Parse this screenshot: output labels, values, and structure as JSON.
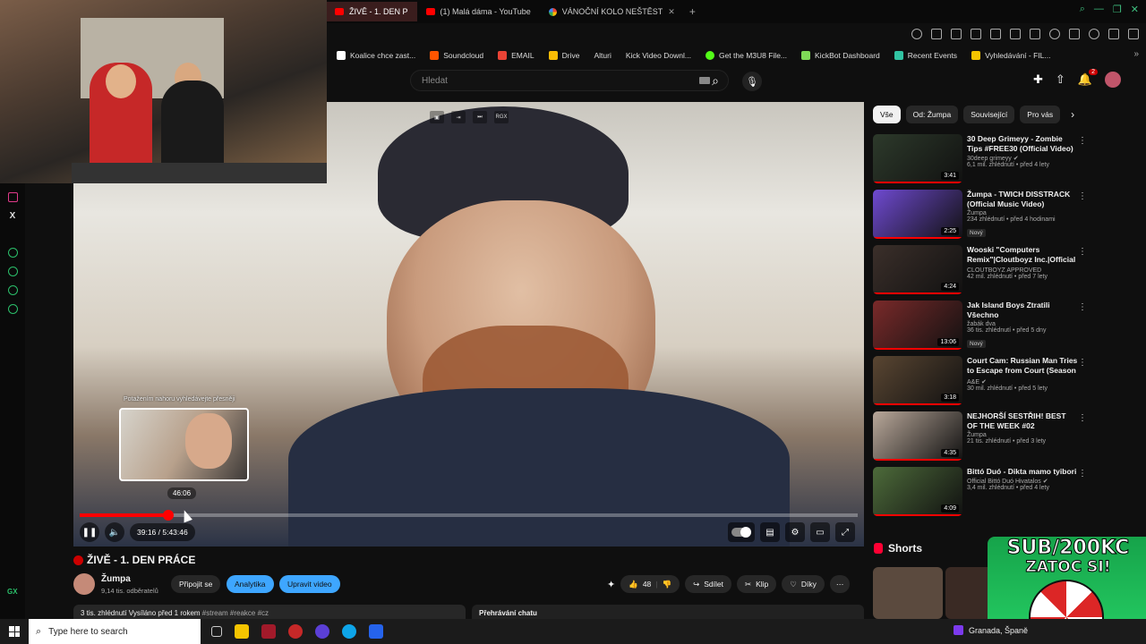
{
  "tabs": [
    {
      "label": "ŽIVĚ - 1. DEN P",
      "active": true
    },
    {
      "label": "(1) Malá dáma - YouTube",
      "active": false
    },
    {
      "label": "VÁNOČNÍ KOLO NEŠTĚST",
      "active": false
    }
  ],
  "bookmarks": [
    "Koalice chce zast...",
    "Soundcloud",
    "EMAIL",
    "Drive",
    "Alturi",
    "Kick Video Downl...",
    "Get the M3U8 File...",
    "KickBot Dashboard",
    "Recent Events",
    "Vyhledávání - FIL..."
  ],
  "search": {
    "placeholder": "Hledat"
  },
  "header": {
    "notifications": "2"
  },
  "player": {
    "preview_hint": "Potažením nahoru vyhledávejte přesněji",
    "hover_time": "46:06",
    "time": "39:16 / 5:43:46",
    "progress": 0.114
  },
  "video": {
    "title": "ŽIVĚ - 1. DEN PRÁCE",
    "channel": "Žumpa",
    "subscribers": "9,14 tis. odběratelů",
    "join_label": "Připojit se",
    "analytics_label": "Analytika",
    "edit_label": "Upravit video",
    "likes": "48",
    "share_label": "Sdílet",
    "clip_label": "Klip",
    "thanks_label": "Díky",
    "desc_stats": "3 tis. zhlédnutí  Vysíláno před 1 rokem",
    "desc_tags": "#stream #reakce #cz",
    "chat_replay": "Přehrávání chatu"
  },
  "chips": [
    "Vše",
    "Od: Žumpa",
    "Související",
    "Pro vás"
  ],
  "recommendations": [
    {
      "title": "30 Deep Grimeyy - Zombie Tips #FREE30 (Official Video)",
      "channel": "30deep grimeyy",
      "verified": true,
      "stats": "6,1 mil. zhlédnutí • před 4 lety",
      "duration": "3:41",
      "badge": "",
      "color": "#2d3a2b"
    },
    {
      "title": "Žumpa - TWICH DISSTRACK (Official Music Video)",
      "channel": "Žumpa",
      "verified": false,
      "stats": "234 zhlédnutí • před 4 hodinami",
      "duration": "2:25",
      "badge": "Nový",
      "color": "#6f4ad1"
    },
    {
      "title": "Wooski \"Computers Remix\"|Cloutboyz Inc.|Official ...",
      "channel": "CLOUTBOYZ APPROVED",
      "verified": false,
      "stats": "42 mil. zhlédnutí • před 7 lety",
      "duration": "4:24",
      "badge": "",
      "color": "#3b2f2a"
    },
    {
      "title": "Jak Island Boys Ztratili Všechno",
      "channel": "žabák dva",
      "verified": false,
      "stats": "36 tis. zhlédnutí • před 5 dny",
      "duration": "13:06",
      "badge": "Nový",
      "color": "#7a2a2a"
    },
    {
      "title": "Court Cam: Russian Man Tries to Escape from Court (Season ...",
      "channel": "A&E",
      "verified": true,
      "stats": "30 mil. zhlédnutí • před 5 lety",
      "duration": "3:18",
      "badge": "",
      "color": "#5a4632"
    },
    {
      "title": "NEJHORŠÍ SESTŘIH! BEST OF THE WEEK #02",
      "channel": "Žumpa",
      "verified": false,
      "stats": "21 tis. zhlédnutí • před 3 lety",
      "duration": "4:35",
      "badge": "",
      "color": "#b9a89a"
    },
    {
      "title": "Bittó Duó - Dikta mamo tyibori",
      "channel": "Official Bittó Duó Hivatalos",
      "verified": true,
      "stats": "3,4 mil. zhlédnutí • před 4 lety",
      "duration": "4:09",
      "badge": "",
      "color": "#4d6b3a"
    }
  ],
  "shorts": {
    "title": "Shorts"
  },
  "promo": {
    "line1": "SUB/200KC",
    "line2": "ZATOC SI!"
  },
  "taskbar": {
    "search_placeholder": "Type here to search",
    "weather": "Granada, Španě"
  },
  "colors": {
    "accent": "#ff0000",
    "blue_button": "#3ea6ff",
    "bg": "#0f0f0f"
  }
}
